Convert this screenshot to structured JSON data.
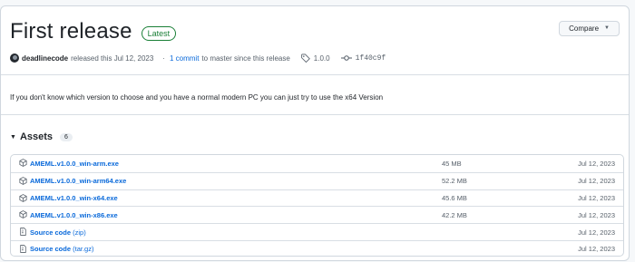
{
  "release": {
    "title": "First release",
    "badge": "Latest",
    "compare_label": "Compare",
    "author": "deadlinecode",
    "released_text": "released this Jul 12, 2023",
    "commits_link": "1 commit",
    "commits_suffix": "to master since this release",
    "tag": "1.0.0",
    "commit_sha": "1f40c9f"
  },
  "description": "If you don't know which version to choose and you have a normal modern PC you can just try to use the x64 Version",
  "assets": {
    "label": "Assets",
    "count": "6",
    "items": [
      {
        "icon": "package-icon",
        "name": "AMEML.v1.0.0_win-arm.exe",
        "name_suffix": "",
        "size": "45 MB",
        "date": "Jul 12, 2023"
      },
      {
        "icon": "package-icon",
        "name": "AMEML.v1.0.0_win-arm64.exe",
        "name_suffix": "",
        "size": "52.2 MB",
        "date": "Jul 12, 2023"
      },
      {
        "icon": "package-icon",
        "name": "AMEML.v1.0.0_win-x64.exe",
        "name_suffix": "",
        "size": "45.6 MB",
        "date": "Jul 12, 2023"
      },
      {
        "icon": "package-icon",
        "name": "AMEML.v1.0.0_win-x86.exe",
        "name_suffix": "",
        "size": "42.2 MB",
        "date": "Jul 12, 2023"
      },
      {
        "icon": "file-zip-icon",
        "name": "Source code",
        "name_suffix": "(zip)",
        "size": "",
        "date": "Jul 12, 2023"
      },
      {
        "icon": "file-zip-icon",
        "name": "Source code",
        "name_suffix": "(tar.gz)",
        "size": "",
        "date": "Jul 12, 2023"
      }
    ]
  }
}
